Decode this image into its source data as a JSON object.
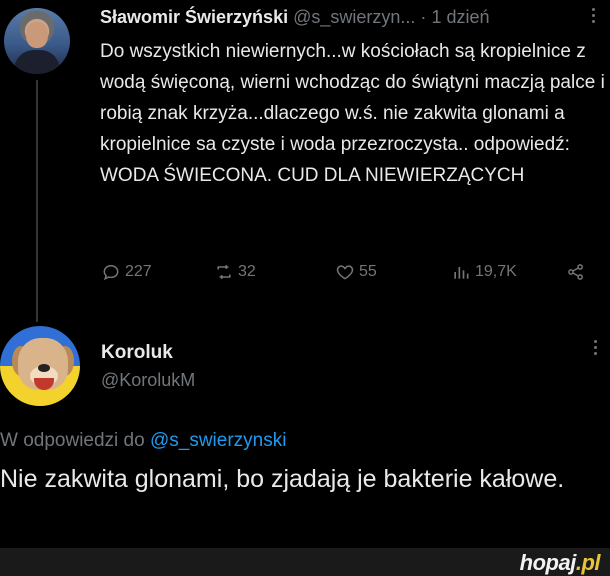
{
  "tweet": {
    "author_name": "Sławomir Świerzyński",
    "author_handle": "@s_swierzyn...",
    "separator": "·",
    "time": "1 dzień",
    "text": "Do wszystkich niewiernych...w kościołach są kropielnice z wodą święconą, wierni wchodząc do świątyni maczją palce i robią znak krzyża...dlaczego w.ś. nie zakwita glonami a kropielnice sa czyste i woda przezroczysta.. odpowiedź: WODA ŚWIECONA. CUD DLA NIEWIERZĄCYCH",
    "actions": {
      "replies": "227",
      "retweets": "32",
      "likes": "55",
      "views": "19,7K"
    },
    "icons": [
      "reply-icon",
      "retweet-icon",
      "like-icon",
      "views-icon",
      "share-icon",
      "more-icon"
    ]
  },
  "reply": {
    "author_name": "Koroluk",
    "author_handle": "@KorolukM",
    "replying_to_prefix": "W odpowiedzi do",
    "replying_to_handle": "@s_swierzynski",
    "text": "Nie zakwita glonami, bo zjadają je bakterie kałowe."
  },
  "watermark": {
    "brand": "hopaj",
    "tld": ".pl"
  },
  "colors": {
    "background": "#000000",
    "text": "#e7e9ea",
    "muted": "#71767b",
    "mention": "#1d9bf0",
    "brand_accent": "#e8c43a"
  }
}
